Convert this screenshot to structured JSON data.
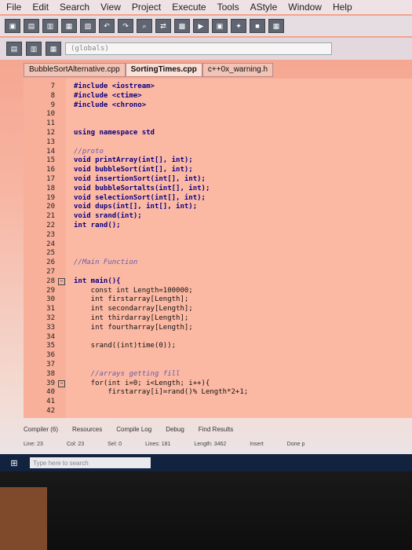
{
  "menu": [
    "File",
    "Edit",
    "Search",
    "View",
    "Project",
    "Execute",
    "Tools",
    "AStyle",
    "Window",
    "Help"
  ],
  "toolbar2": {
    "scope_value": "(globals)"
  },
  "tabs": [
    "BubbleSortAlternative.cpp",
    "SortingTimes.cpp",
    "c++0x_warning.h"
  ],
  "code_lines": [
    {
      "n": "7",
      "t": "#include <iostream>"
    },
    {
      "n": "8",
      "t": "#include <ctime>"
    },
    {
      "n": "9",
      "t": "#include <chrono>"
    },
    {
      "n": "10",
      "t": ""
    },
    {
      "n": "11",
      "t": ""
    },
    {
      "n": "12",
      "t": "using namespace std"
    },
    {
      "n": "13",
      "t": ""
    },
    {
      "n": "14",
      "t": "//proto"
    },
    {
      "n": "15",
      "t": "void printArray(int[], int);"
    },
    {
      "n": "16",
      "t": "void bubbleSort(int[], int);"
    },
    {
      "n": "17",
      "t": "void insertionSort(int[], int);"
    },
    {
      "n": "18",
      "t": "void bubbleSortalts(int[], int);"
    },
    {
      "n": "19",
      "t": "void selectionSort(int[], int);"
    },
    {
      "n": "20",
      "t": "void dups(int[], int[], int);"
    },
    {
      "n": "21",
      "t": "void srand(int);"
    },
    {
      "n": "22",
      "t": "int rand();"
    },
    {
      "n": "23",
      "t": ""
    },
    {
      "n": "24",
      "t": ""
    },
    {
      "n": "25",
      "t": ""
    },
    {
      "n": "26",
      "t": "//Main Function"
    },
    {
      "n": "27",
      "t": ""
    },
    {
      "n": "28",
      "t": "int main(){"
    },
    {
      "n": "29",
      "t": "    const int Length=100000;"
    },
    {
      "n": "30",
      "t": "    int firstarray[Length];"
    },
    {
      "n": "31",
      "t": "    int secondarray[Length];"
    },
    {
      "n": "32",
      "t": "    int thirdarray[Length];"
    },
    {
      "n": "33",
      "t": "    int fourtharray[Length];"
    },
    {
      "n": "34",
      "t": ""
    },
    {
      "n": "35",
      "t": "    srand((int)time(0));"
    },
    {
      "n": "36",
      "t": ""
    },
    {
      "n": "37",
      "t": ""
    },
    {
      "n": "38",
      "t": "    //arrays getting fill"
    },
    {
      "n": "39",
      "t": "    for(int i=0; i<Length; i++){"
    },
    {
      "n": "40",
      "t": "        firstarray[i]=rand()% Length*2+1;"
    },
    {
      "n": "41",
      "t": ""
    },
    {
      "n": "42",
      "t": ""
    }
  ],
  "bottom_tabs": [
    "Compiler (6)",
    "Resources",
    "Compile Log",
    "Debug",
    "Find Results"
  ],
  "status": {
    "line_label": "Line:",
    "line_value": "23",
    "col_label": "Col:",
    "col_value": "23",
    "sel_label": "Sel:",
    "sel_value": "0",
    "lines_label": "Lines:",
    "lines_value": "181",
    "length_label": "Length:",
    "length_value": "3462",
    "mode": "Insert",
    "done": "Done p"
  },
  "taskbar": {
    "search_placeholder": "Type here to search"
  }
}
